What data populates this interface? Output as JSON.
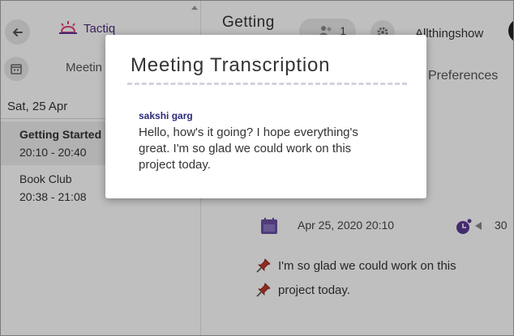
{
  "sidebar": {
    "logo_text": "Tactiq",
    "tab_label": "Meetin",
    "date_header": "Sat, 25 Apr",
    "meetings": [
      {
        "title": "Getting Started",
        "time": "20:10 - 20:40",
        "active": true
      },
      {
        "title": "Book Club",
        "time": "20:38 - 21:08",
        "active": false
      }
    ]
  },
  "header": {
    "title": "Getting",
    "participants_count": "1",
    "workspace": "Allthingshow",
    "tab_preferences": "Preferences"
  },
  "entry": {
    "date": "Apr 25, 2020 20:10",
    "duration": "30",
    "lines": [
      "I'm so glad we could work on this",
      "project today."
    ]
  },
  "modal": {
    "title": "Meeting Transcription",
    "speaker": "sakshi garg",
    "text": "Hello, how's it going? I hope everything's great. I'm so glad we could work on this project today."
  },
  "colors": {
    "brand_purple": "#5b3a94",
    "logo_pink": "#e0447a",
    "speaker_navy": "#2b2a7a",
    "pin_red": "#c0392b"
  },
  "icons": [
    "back-arrow-icon",
    "calendar-icon",
    "people-icon",
    "gear-icon",
    "clock-icon",
    "play-icon",
    "pin-icon"
  ]
}
